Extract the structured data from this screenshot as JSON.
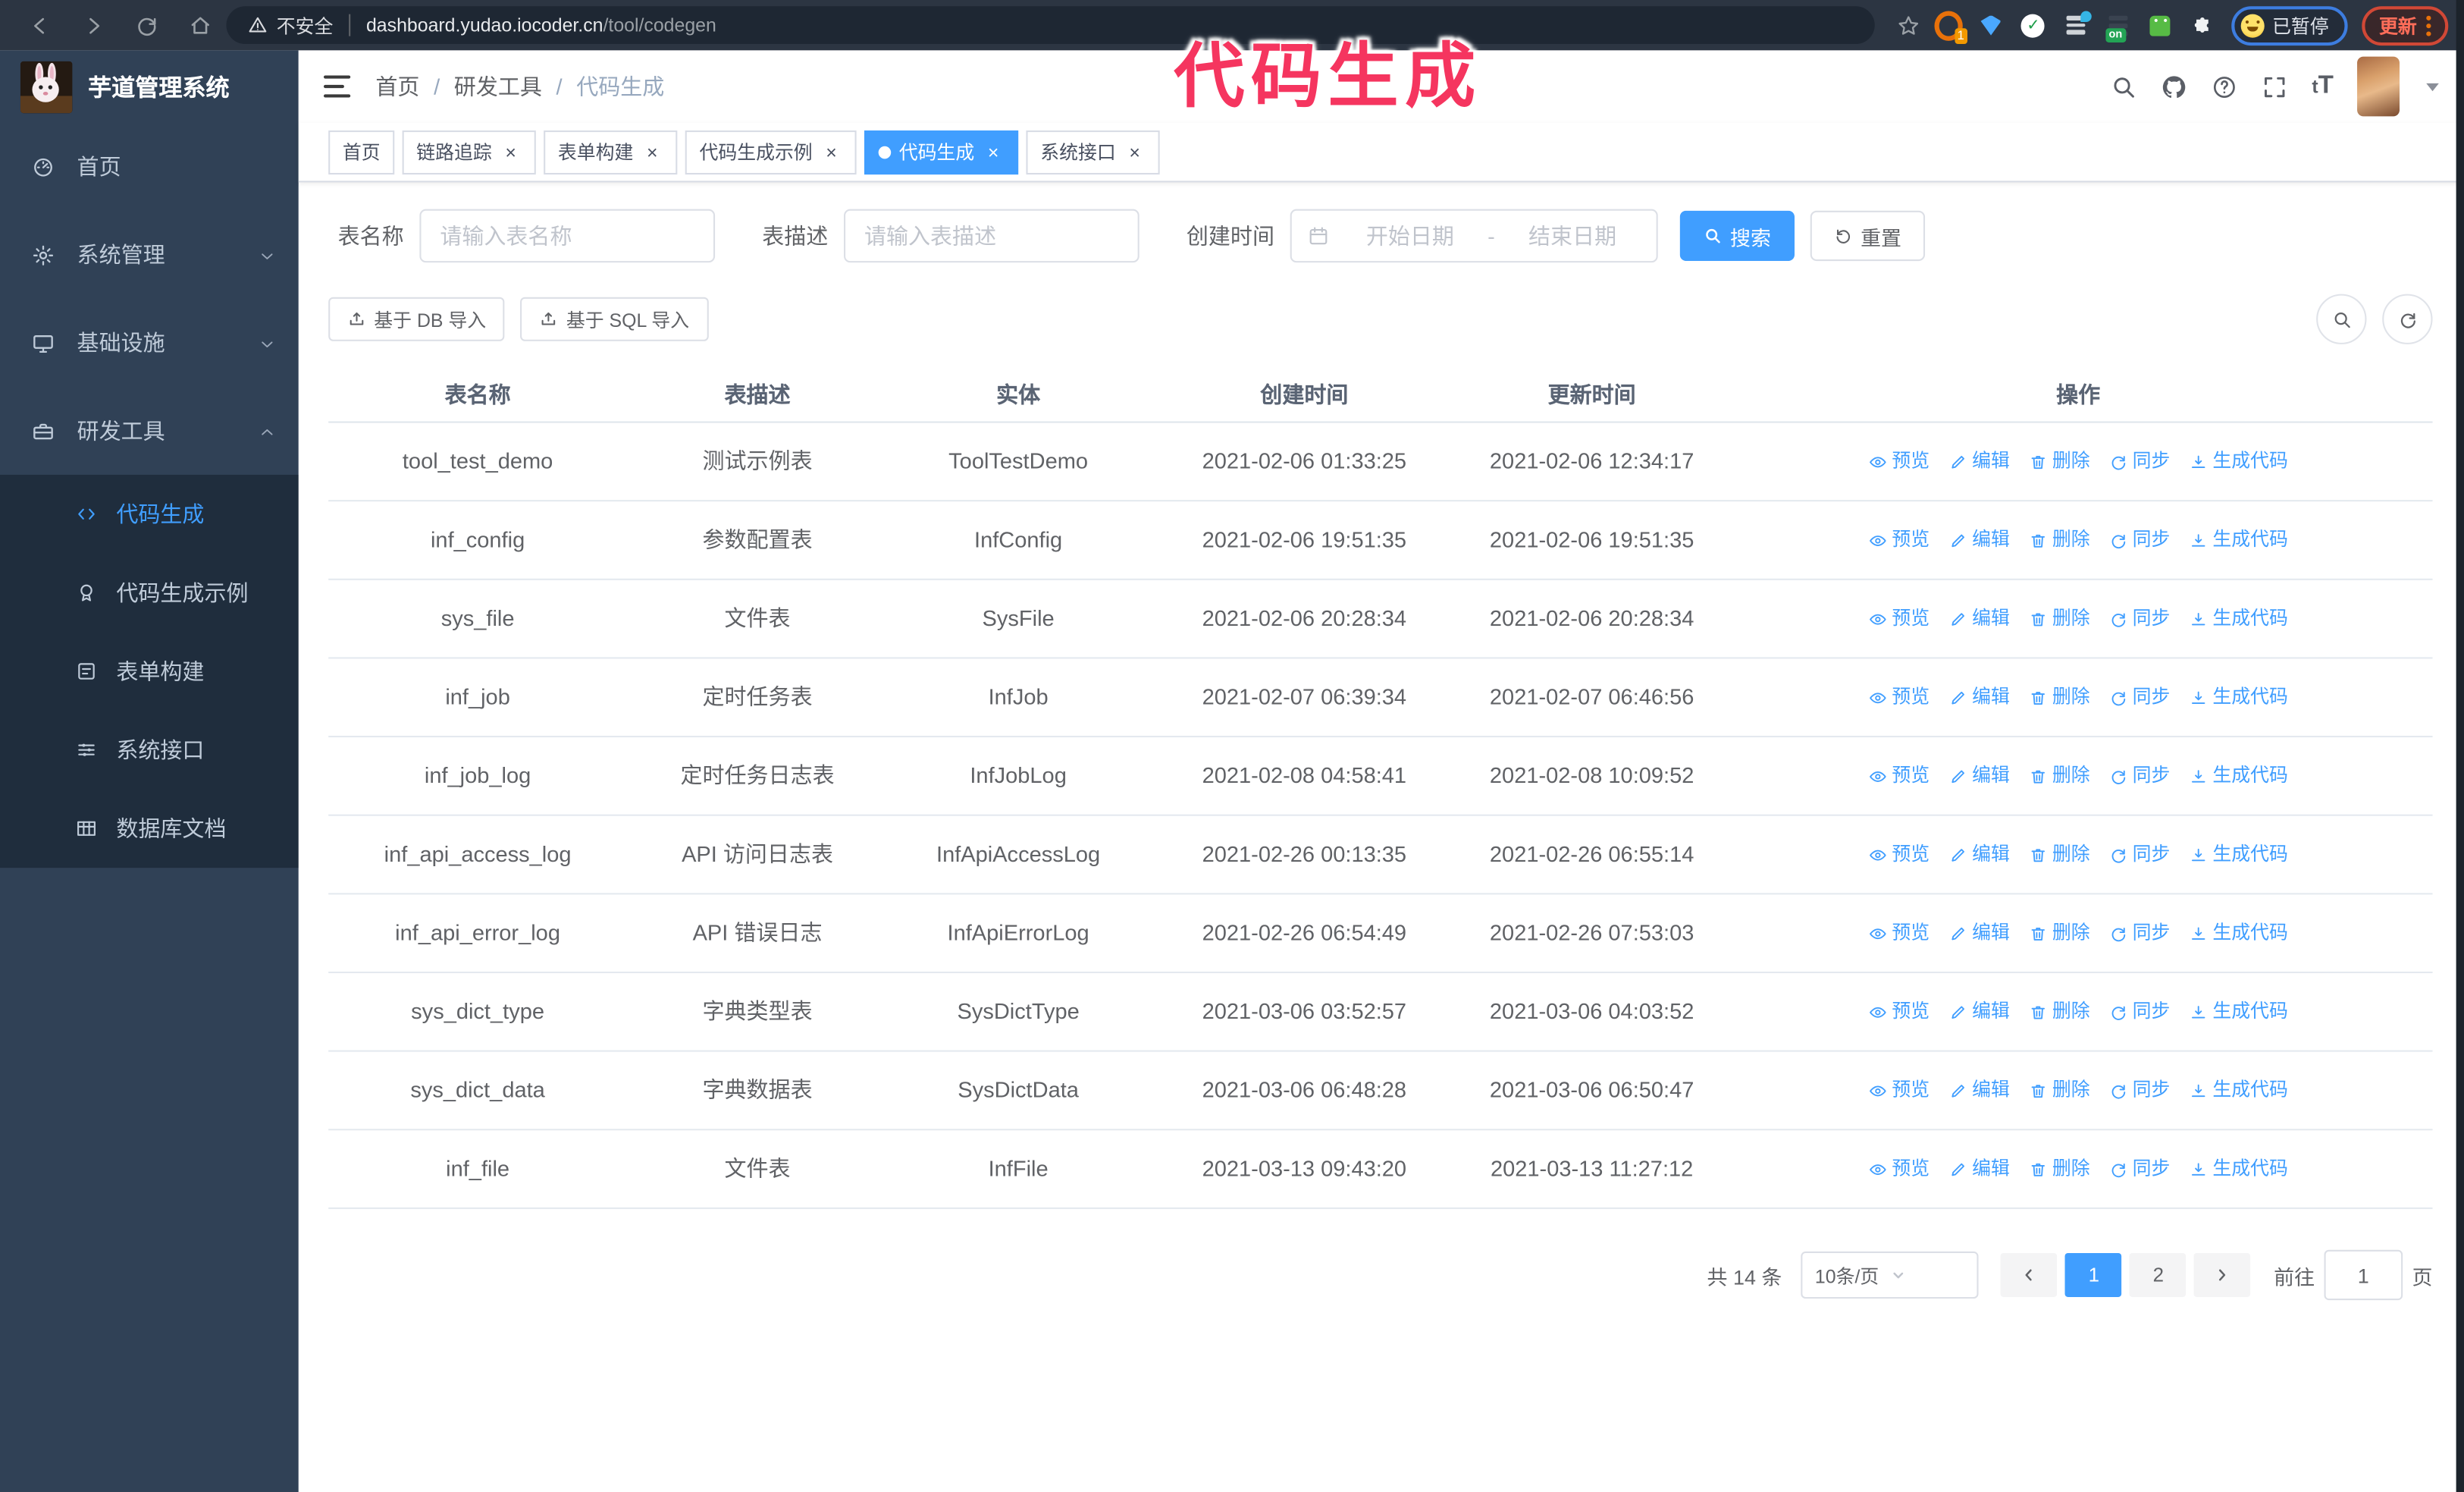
{
  "colors": {
    "accent": "#409eff",
    "overlay_pink": "#f5355f",
    "sidebar_bg": "#304156",
    "submenu_bg": "#1f2d3d"
  },
  "browser": {
    "security_label": "不安全",
    "url_host": "dashboard.yudao.iocoder.cn",
    "url_path": "/tool/codegen",
    "ext_badge": "1",
    "ext_on_badge": "on",
    "paused_label": "已暂停",
    "update_label": "更新"
  },
  "overlay": {
    "title": "代码生成"
  },
  "app": {
    "logo_title": "芋道管理系统",
    "breadcrumb": [
      "首页",
      "研发工具",
      "代码生成"
    ],
    "sidebar": {
      "items": [
        {
          "label": "首页",
          "icon": "dashboard-icon",
          "expandable": false
        },
        {
          "label": "系统管理",
          "icon": "gear-icon",
          "expandable": true,
          "expanded": false
        },
        {
          "label": "基础设施",
          "icon": "monitor-icon",
          "expandable": true,
          "expanded": false
        },
        {
          "label": "研发工具",
          "icon": "toolbox-icon",
          "expandable": true,
          "expanded": true
        }
      ],
      "submenu": [
        {
          "label": "代码生成",
          "icon": "code-icon",
          "active": true
        },
        {
          "label": "代码生成示例",
          "icon": "certificate-icon",
          "active": false
        },
        {
          "label": "表单构建",
          "icon": "form-icon",
          "active": false
        },
        {
          "label": "系统接口",
          "icon": "api-icon",
          "active": false
        },
        {
          "label": "数据库文档",
          "icon": "database-doc-icon",
          "active": false
        }
      ]
    },
    "navbar": {
      "font_size_icon": "tT"
    },
    "tags": [
      {
        "label": "首页",
        "closable": false,
        "active": false
      },
      {
        "label": "链路追踪",
        "closable": true,
        "active": false
      },
      {
        "label": "表单构建",
        "closable": true,
        "active": false
      },
      {
        "label": "代码生成示例",
        "closable": true,
        "active": false
      },
      {
        "label": "代码生成",
        "closable": true,
        "active": true
      },
      {
        "label": "系统接口",
        "closable": true,
        "active": false
      }
    ],
    "search": {
      "name_label": "表名称",
      "name_placeholder": "请输入表名称",
      "desc_label": "表描述",
      "desc_placeholder": "请输入表描述",
      "time_label": "创建时间",
      "start_placeholder": "开始日期",
      "range_separator": "-",
      "end_placeholder": "结束日期",
      "search_label": "搜索",
      "reset_label": "重置"
    },
    "toolbar": {
      "db_import": "基于 DB 导入",
      "sql_import": "基于 SQL 导入"
    },
    "table": {
      "headers": [
        "表名称",
        "表描述",
        "实体",
        "创建时间",
        "更新时间",
        "操作"
      ],
      "action_labels": [
        "预览",
        "编辑",
        "删除",
        "同步",
        "生成代码"
      ],
      "rows": [
        {
          "name": "tool_test_demo",
          "desc": "测试示例表",
          "entity": "ToolTestDemo",
          "create": "2021-02-06 01:33:25",
          "update": "2021-02-06 12:34:17",
          "create_wrap": false,
          "update_wrap": false
        },
        {
          "name": "inf_config",
          "desc": "参数配置表",
          "entity": "InfConfig",
          "create": "2021-02-06 19:51:35",
          "update": "2021-02-06 19:51:35",
          "create_wrap": false,
          "update_wrap": false
        },
        {
          "name": "sys_file",
          "desc": "文件表",
          "entity": "SysFile",
          "create": "2021-02-06 20:28:34",
          "update": "2021-02-06 20:28:34",
          "create_wrap": true,
          "update_wrap": true
        },
        {
          "name": "inf_job",
          "desc": "定时任务表",
          "entity": "InfJob",
          "create": "2021-02-07 06:39:34",
          "update": "2021-02-07 06:46:56",
          "create_wrap": true,
          "update_wrap": true
        },
        {
          "name": "inf_job_log",
          "desc": "定时任务日志表",
          "entity": "InfJobLog",
          "create": "2021-02-08 04:58:41",
          "update": "2021-02-08 10:09:52",
          "create_wrap": true,
          "update_wrap": true
        },
        {
          "name": "inf_api_access_log",
          "desc": "API 访问日志表",
          "entity": "InfApiAccessLog",
          "create": "2021-02-26 00:13:35",
          "update": "2021-02-26 06:55:14",
          "create_wrap": false,
          "update_wrap": true
        },
        {
          "name": "inf_api_error_log",
          "desc": "API 错误日志",
          "entity": "InfApiErrorLog",
          "create": "2021-02-26 06:54:49",
          "update": "2021-02-26 07:53:03",
          "create_wrap": true,
          "update_wrap": true
        },
        {
          "name": "sys_dict_type",
          "desc": "字典类型表",
          "entity": "SysDictType",
          "create": "2021-03-06 03:52:57",
          "update": "2021-03-06 04:03:52",
          "create_wrap": true,
          "update_wrap": true
        },
        {
          "name": "sys_dict_data",
          "desc": "字典数据表",
          "entity": "SysDictData",
          "create": "2021-03-06 06:48:28",
          "update": "2021-03-06 06:50:47",
          "create_wrap": true,
          "update_wrap": true
        },
        {
          "name": "inf_file",
          "desc": "文件表",
          "entity": "InfFile",
          "create": "2021-03-13 09:43:20",
          "update": "2021-03-13 11:27:12",
          "create_wrap": true,
          "update_wrap": false
        }
      ]
    },
    "pagination": {
      "total": "共 14 条",
      "page_size": "10条/页",
      "pages": [
        "1",
        "2"
      ],
      "active_page": "1",
      "goto_label": "前往",
      "goto_value": "1",
      "page_unit": "页"
    }
  }
}
